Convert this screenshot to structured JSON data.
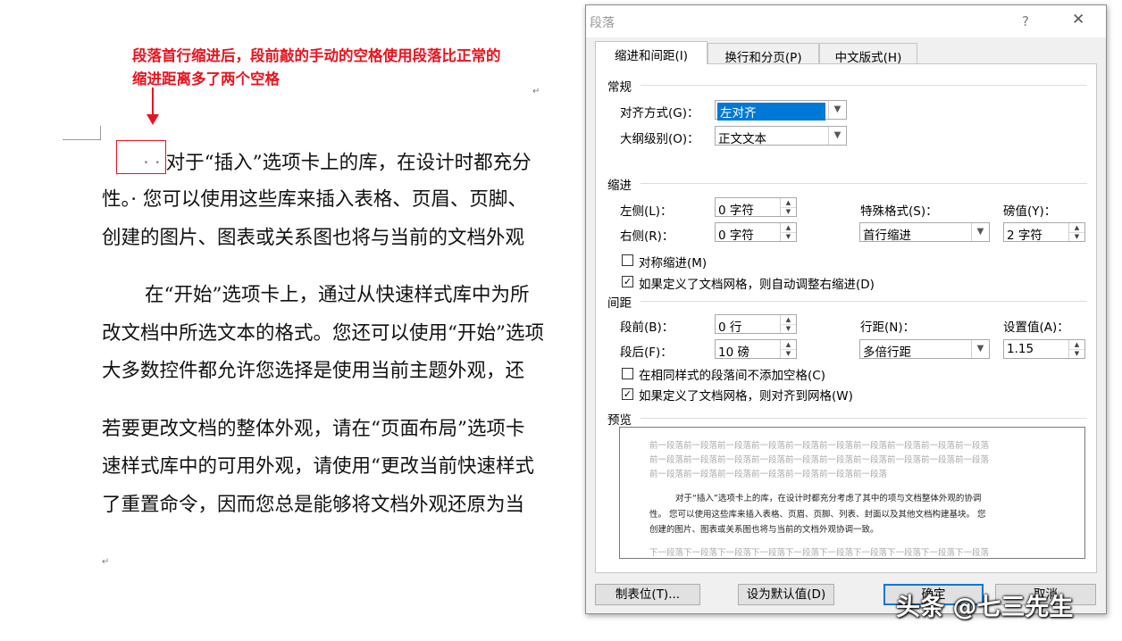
{
  "annotation": {
    "line1": "段落首行缩进后，段前敲的手动的空格使用段落比正常的",
    "line2": "缩进距离多了两个空格"
  },
  "document": {
    "para_mark": "↵",
    "leading_dots": "··",
    "lines": [
      "对于“插入”选项卡上的库，在设计时都充分",
      "性。· 您可以使用这些库来插入表格、页眉、页脚、",
      "创建的图片、图表或关系图也将与当前的文档外观",
      "在“开始”选项卡上，通过从快速样式库中为所",
      "改文档中所选文本的格式。您还可以使用“开始”选项",
      "大多数控件都允许您选择是使用当前主题外观，还",
      "若要更改文档的整体外观，请在“页面布局”选项卡",
      "速样式库中的可用外观，请使用“更改当前快速样式",
      "了重置命令，因而您总是能够将文档外观还原为当"
    ]
  },
  "dialog": {
    "title": "段落",
    "help_glyph": "?",
    "close_glyph": "✕",
    "tabs": [
      {
        "label": "缩进和间距(I)"
      },
      {
        "label": "换行和分页(P)"
      },
      {
        "label": "中文版式(H)"
      }
    ],
    "general": {
      "section": "常规",
      "alignment_label": "对齐方式(G)：",
      "alignment_value": "左对齐",
      "outline_label": "大纲级别(O)：",
      "outline_value": "正文文本"
    },
    "indent": {
      "section": "缩进",
      "left_label": "左侧(L)：",
      "left_value": "0 字符",
      "right_label": "右侧(R)：",
      "right_value": "0 字符",
      "special_label": "特殊格式(S)：",
      "special_value": "首行缩进",
      "by_label": "磅值(Y)：",
      "by_value": "2 字符",
      "mirror_label": "对称缩进(M)",
      "mirror_checked": false,
      "auto_adjust_label": "如果定义了文档网格，则自动调整右缩进(D)",
      "auto_adjust_checked": true
    },
    "spacing": {
      "section": "间距",
      "before_label": "段前(B)：",
      "before_value": "0 行",
      "after_label": "段后(F)：",
      "after_value": "10 磅",
      "line_spacing_label": "行距(N)：",
      "line_spacing_value": "多倍行距",
      "at_label": "设置值(A)：",
      "at_value": "1.15",
      "no_space_label": "在相同样式的段落间不添加空格(C)",
      "no_space_checked": false,
      "snap_grid_label": "如果定义了文档网格，则对齐到网格(W)",
      "snap_grid_checked": true
    },
    "preview": {
      "section": "预览",
      "prev_lines": [
        "前一段落前一段落前一段落前一段落前一段落前一段落前一段落前一段落前一段落前一段落",
        "前一段落前一段落前一段落前一段落前一段落前一段落前一段落前一段落前一段落前一段落",
        "前一段落前一段落前一段落前一段落前一段落前一段落前一段落"
      ],
      "sample_lines": [
        "对于“插入”选项卡上的库，在设计时都充分考虑了其中的项与文档整体外观的协调",
        "性。 您可以使用这些库来插入表格、页眉、页脚、列表、封面以及其他文档构建基块。 您",
        "创建的图片、图表或关系图也将与当前的文档外观协调一致。"
      ],
      "next_lines": [
        "下一段落下一段落下一段落下一段落下一段落下一段落下一段落下一段落下一段落下一段落"
      ]
    },
    "buttons": {
      "tabs_button": "制表位(T)...",
      "default_button": "设为默认值(D)",
      "ok_button": "确定",
      "cancel_button": "取消"
    },
    "watermark": "头条 @七三先生"
  }
}
